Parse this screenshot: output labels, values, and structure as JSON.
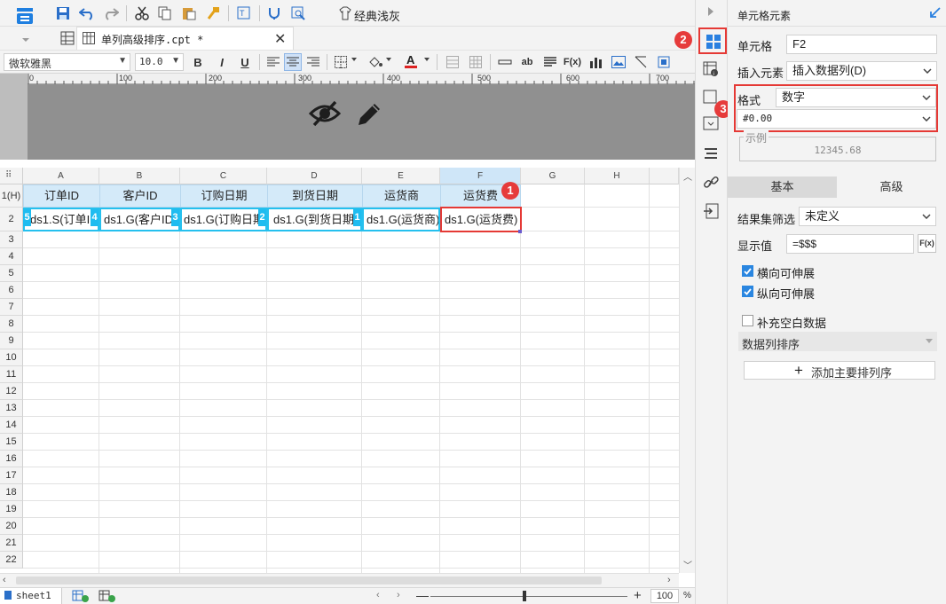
{
  "toolbar": {
    "theme_label": "经典浅灰",
    "file_tab": "单列高级排序.cpt *",
    "font_name": "微软雅黑",
    "font_size": "10.0"
  },
  "ruler": {
    "ticks": [
      "0",
      "100",
      "200",
      "300",
      "400",
      "500",
      "600",
      "700"
    ]
  },
  "grid": {
    "columns": [
      "A",
      "B",
      "C",
      "D",
      "E",
      "F",
      "G",
      "H"
    ],
    "row_labels": [
      "1(H)",
      "2",
      "3",
      "4",
      "5",
      "6",
      "7",
      "8",
      "9",
      "10",
      "11",
      "12",
      "13",
      "14",
      "15",
      "16",
      "17",
      "18",
      "19",
      "20",
      "21",
      "22"
    ],
    "header_cells": [
      "订单ID",
      "客户ID",
      "订购日期",
      "到货日期",
      "运货商",
      "运货费"
    ],
    "data_cells": [
      "ds1.S(订单ID",
      "ds1.G(客户ID",
      "ds1.G(订购日期",
      "ds1.G(到货日期",
      "ds1.G(运货商)",
      "ds1.G(运货费)"
    ],
    "tags": [
      "5",
      "4",
      "3",
      "2",
      "1"
    ]
  },
  "sheetbar": {
    "sheet_name": "sheet1",
    "zoom": "100",
    "percent": "%"
  },
  "panel": {
    "title": "单元格元素",
    "cell_label": "单元格",
    "cell_value": "F2",
    "insert_label": "插入元素",
    "insert_value": "插入数据列(D)",
    "format_label": "格式",
    "format_value": "数字",
    "pattern_value": "#0.00",
    "example_legend": "示例",
    "example_value": "12345.68",
    "tab_basic": "基本",
    "tab_advanced": "高级",
    "filter_label": "结果集筛选",
    "filter_value": "未定义",
    "display_label": "显示值",
    "display_value": "=$$$",
    "fx_label": "F(x)",
    "h_expand": "横向可伸展",
    "v_expand": "纵向可伸展",
    "fill_blank": "补充空白数据",
    "sort_header": "数据列排序",
    "add_sort": "添加主要排列序"
  },
  "badges": {
    "b1": "1",
    "b2": "2",
    "b3": "3"
  },
  "colors": {
    "accent": "#1f7fe0",
    "badge": "#e63b3b",
    "highlight_border": "#e53935",
    "cell_tag": "#1fbcf0"
  }
}
